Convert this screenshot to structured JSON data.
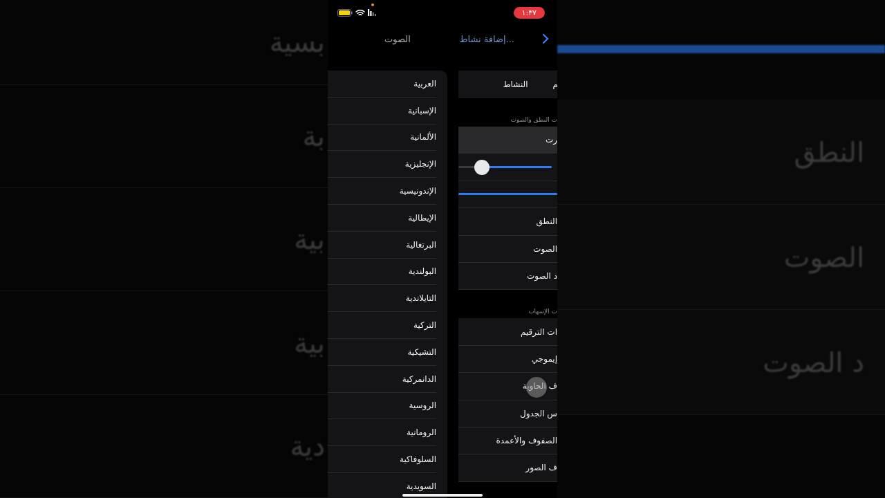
{
  "background": {
    "left_fragments": [
      "بسية",
      "بة",
      "بية",
      "بية",
      "دية"
    ],
    "right_fragments": [
      "النطق",
      "الصوت",
      "د الصوت"
    ]
  },
  "status_bar": {
    "time": "١:٣٧"
  },
  "nav": {
    "back_label": "إضافة نشاط...",
    "title": "الصوت"
  },
  "languages": [
    {
      "label": "العربية"
    },
    {
      "label": "الإسبانية"
    },
    {
      "label": "الألمانية"
    },
    {
      "label": "الإنجليزية"
    },
    {
      "label": "الإندونيسية"
    },
    {
      "label": "الإيطالية"
    },
    {
      "label": "البرتغالية"
    },
    {
      "label": "البولندية"
    },
    {
      "label": "التايلاندية"
    },
    {
      "label": "التركية"
    },
    {
      "label": "التشيكية"
    },
    {
      "label": "الدانمركية"
    },
    {
      "label": "الروسية"
    },
    {
      "label": "الرومانية"
    },
    {
      "label": "السلوفاكية"
    },
    {
      "label": "السويدية"
    }
  ],
  "settings": {
    "top_row": [
      "م",
      "النشاط"
    ],
    "sections": [
      {
        "header": "ت النطق والصوت",
        "rows": [
          {
            "kind": "text",
            "label": "رت",
            "selected": true
          },
          {
            "kind": "slider",
            "level": 0.76
          },
          {
            "kind": "bar",
            "level": 1
          },
          {
            "kind": "text",
            "label": "النطق",
            "selected": false
          },
          {
            "kind": "text",
            "label": "الصوت",
            "selected": false
          },
          {
            "kind": "text",
            "label": "د الصوت",
            "selected": false
          }
        ]
      },
      {
        "header": "ت الإسهاب",
        "rows": [
          {
            "kind": "text",
            "label": "ات الترقيم",
            "selected": false
          },
          {
            "kind": "text",
            "label": "إيموجي",
            "selected": false
          },
          {
            "kind": "text",
            "label": "ف الحاوية",
            "selected": false,
            "touched": true
          },
          {
            "kind": "text",
            "label": "س الجدول",
            "selected": false
          },
          {
            "kind": "text",
            "label": "الصفوف والأعمدة",
            "selected": false
          },
          {
            "kind": "text",
            "label": "ف الصور",
            "selected": false
          }
        ]
      }
    ]
  }
}
